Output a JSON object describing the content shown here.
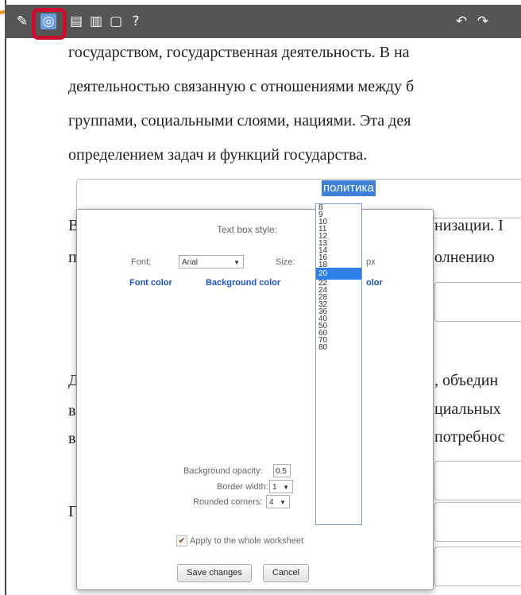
{
  "toolbar": {
    "buttons": [
      {
        "name": "edit-icon",
        "glyph": "✎"
      },
      {
        "name": "text-style-icon",
        "glyph": "◎"
      },
      {
        "name": "answer-sheet-icon",
        "glyph": "▤"
      },
      {
        "name": "answer-key-icon",
        "glyph": "▥"
      },
      {
        "name": "tip-icon",
        "glyph": "▢"
      },
      {
        "name": "help-icon",
        "glyph": "?"
      },
      {
        "name": "undo-icon",
        "glyph": "↶"
      },
      {
        "name": "redo-icon",
        "glyph": "↷"
      }
    ],
    "help_label": "?"
  },
  "document": {
    "line1": "государством, государственная деятельность. В на",
    "line2": "деятельностью связанную с отношениями между б",
    "line3": "группами, социальными слоями, нациями. Эта дея",
    "line4": "определением задач и функций государства.",
    "selected_answer": "политика",
    "frag_left_1": "В",
    "frag_left_2": "п",
    "frag_right_1": "низации. I",
    "frag_right_2": "олнению",
    "frag_left_3": "Д",
    "frag_left_4": "в",
    "frag_left_5": "в",
    "frag_right_3": ", объедин",
    "frag_right_4": "циальных",
    "frag_right_5": "потребнос",
    "frag_left_6": "Г"
  },
  "dialog": {
    "title": "Text box style:",
    "font_label": "Font:",
    "font_value": "Arial",
    "size_label": "Size:",
    "size_unit": "px",
    "font_color_link": "Font color",
    "background_color_link": "Background color",
    "border_color_link_fragment": "olor",
    "bg_opacity_label": "Background opacity:",
    "bg_opacity_value": "0.5",
    "border_width_label": "Border width:",
    "border_width_value": "1",
    "rounded_corners_label": "Rounded corners:",
    "rounded_corners_value": "4",
    "apply_label": "Apply to the whole worksheet",
    "apply_checked": true,
    "save_button": "Save changes",
    "cancel_button": "Cancel",
    "size_options": [
      "8",
      "9",
      "10",
      "11",
      "12",
      "13",
      "14",
      "16",
      "18",
      "20",
      "22",
      "24",
      "28",
      "32",
      "36",
      "40",
      "50",
      "60",
      "70",
      "80"
    ],
    "size_selected": "20"
  },
  "colors": {
    "accent": "#2f7fe8",
    "highlight_border": "#c8102e",
    "toolbar_bg": "#555555",
    "link": "#1a56c8"
  }
}
